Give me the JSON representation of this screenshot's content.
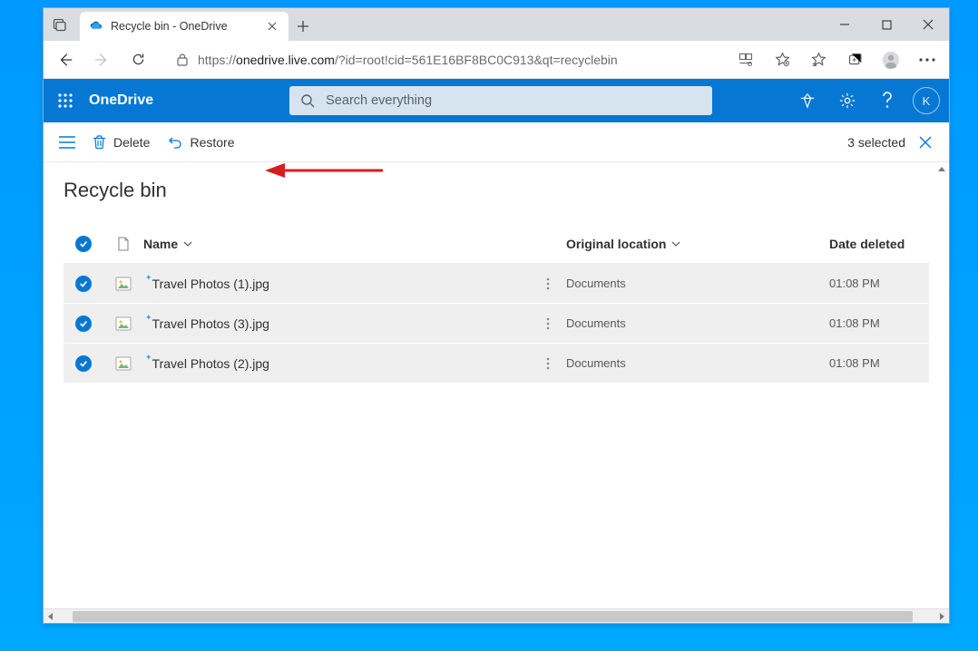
{
  "browser": {
    "tab_title": "Recycle bin - OneDrive",
    "url_prefix": "https://",
    "url_host": "onedrive.live.com",
    "url_path": "/?id=root!cid=561E16BF8BC0C913&qt=recyclebin"
  },
  "header": {
    "brand": "OneDrive",
    "search_placeholder": "Search everything",
    "avatar_initial": "K"
  },
  "commandbar": {
    "delete_label": "Delete",
    "restore_label": "Restore",
    "selection_text": "3 selected"
  },
  "page": {
    "title": "Recycle bin",
    "columns": {
      "name": "Name",
      "location": "Original location",
      "date": "Date deleted"
    },
    "rows": [
      {
        "name": "Travel Photos (1).jpg",
        "location": "Documents",
        "date": "01:08 PM"
      },
      {
        "name": "Travel Photos (3).jpg",
        "location": "Documents",
        "date": "01:08 PM"
      },
      {
        "name": "Travel Photos (2).jpg",
        "location": "Documents",
        "date": "01:08 PM"
      }
    ]
  }
}
